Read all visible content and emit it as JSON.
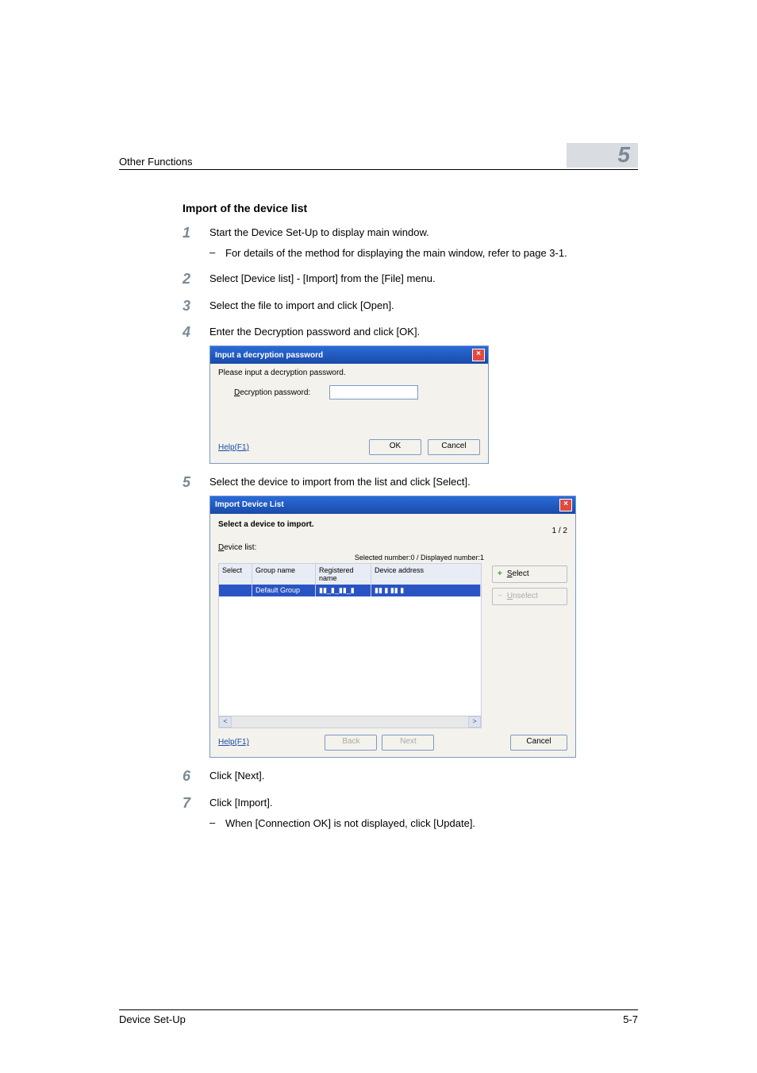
{
  "header": {
    "section_title": "Other Functions",
    "chapter_number": "5"
  },
  "section_heading": "Import of the device list",
  "steps": {
    "s1": {
      "num": "1",
      "text": "Start the Device Set-Up to display main window.",
      "sub": "For details of the method for displaying the main window, refer to page 3-1."
    },
    "s2": {
      "num": "2",
      "text": "Select [Device list] - [Import] from the [File] menu."
    },
    "s3": {
      "num": "3",
      "text": "Select the file to import and click [Open]."
    },
    "s4": {
      "num": "4",
      "text": "Enter the Decryption password and click [OK]."
    },
    "s5": {
      "num": "5",
      "text": "Select the device to import from the list and click [Select]."
    },
    "s6": {
      "num": "6",
      "text": "Click [Next]."
    },
    "s7": {
      "num": "7",
      "text": "Click [Import].",
      "sub": "When [Connection OK] is not displayed, click [Update]."
    }
  },
  "dialog1": {
    "title": "Input a decryption password",
    "instruction": "Please input a decryption password.",
    "field_label_pre": "D",
    "field_label_rest": "ecryption password:",
    "help": "Help(F1)",
    "ok": "OK",
    "cancel": "Cancel"
  },
  "dialog2": {
    "title": "Import Device List",
    "subtitle": "Select a device to import.",
    "counter": "1 / 2",
    "list_label_pre": "D",
    "list_label_rest": "evice list:",
    "status": "Selected number:0 / Displayed number:1",
    "columns": {
      "c1": "Select",
      "c2": "Group name",
      "c3": "Registered name",
      "c4": "Device address"
    },
    "row": {
      "c1": "",
      "c2": "Default Group",
      "c3": "▮▮_▮_▮▮_▮",
      "c4": "▮▮ ▮ ▮▮ ▮"
    },
    "select_btn_pre": "S",
    "select_btn_rest": "elect",
    "unselect_btn_pre": "U",
    "unselect_btn_rest": "nselect",
    "help": "Help(F1)",
    "back_pre": "B",
    "back_rest": "ack",
    "next_pre": "N",
    "next_rest": "ext",
    "cancel": "Cancel"
  },
  "footer": {
    "left": "Device Set-Up",
    "right": "5-7"
  }
}
